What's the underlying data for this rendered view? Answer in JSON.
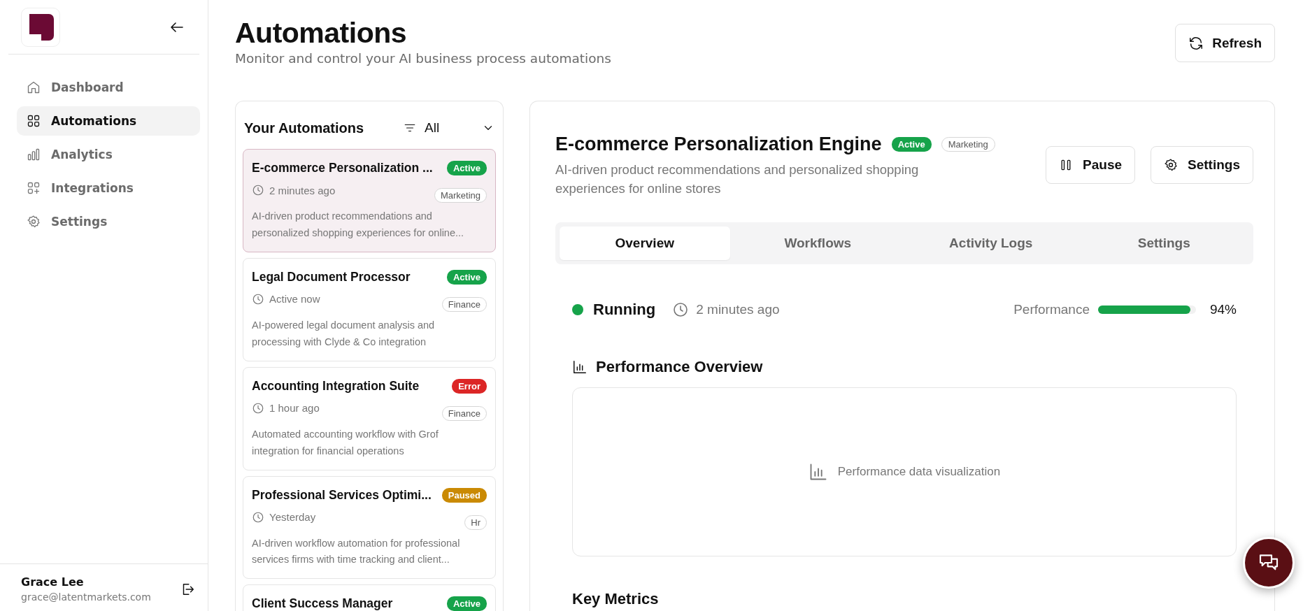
{
  "sidebar": {
    "nav": [
      {
        "label": "Dashboard",
        "selected": false
      },
      {
        "label": "Automations",
        "selected": true
      },
      {
        "label": "Analytics",
        "selected": false
      },
      {
        "label": "Integrations",
        "selected": false
      },
      {
        "label": "Settings",
        "selected": false
      }
    ],
    "user": {
      "name": "Grace Lee",
      "email": "grace@latentmarkets.com"
    }
  },
  "header": {
    "title": "Automations",
    "subtitle": "Monitor and control your AI business process automations",
    "refresh_button": "Refresh"
  },
  "automation_list": {
    "title": "Your Automations",
    "filter": "All",
    "items": [
      {
        "name": "E-commerce Personalization ...",
        "status": {
          "label": "Active",
          "color": "#16a34a"
        },
        "time": "2 minutes ago",
        "tag": "Marketing",
        "description": "AI-driven product recommendations and personalized shopping experiences for online...",
        "selected": true
      },
      {
        "name": "Legal Document Processor",
        "status": {
          "label": "Active",
          "color": "#16a34a"
        },
        "time": "Active now",
        "tag": "Finance",
        "description": "AI-powered legal document analysis and processing with Clyde & Co integration",
        "selected": false
      },
      {
        "name": "Accounting Integration Suite",
        "status": {
          "label": "Error",
          "color": "#dc2626"
        },
        "time": "1 hour ago",
        "tag": "Finance",
        "description": "Automated accounting workflow with Grof integration for financial operations",
        "selected": false
      },
      {
        "name": "Professional Services Optimi...",
        "status": {
          "label": "Paused",
          "color": "#ca8a04"
        },
        "time": "Yesterday",
        "tag": "Hr",
        "description": "AI-driven workflow automation for professional services firms with time tracking and client...",
        "selected": false
      },
      {
        "name": "Client Success Manager",
        "status": {
          "label": "Active",
          "color": "#16a34a"
        },
        "selected": false
      }
    ]
  },
  "detail": {
    "title": "E-commerce Personalization Engine",
    "status": {
      "label": "Active",
      "color": "#16a34a"
    },
    "tag": "Marketing",
    "description": "AI-driven product recommendations and personalized shopping experiences for online stores",
    "buttons": [
      "Pause",
      "Settings"
    ],
    "tabs": [
      {
        "label": "Overview",
        "selected": true
      },
      {
        "label": "Workflows",
        "selected": false
      },
      {
        "label": "Activity Logs",
        "selected": false
      },
      {
        "label": "Settings",
        "selected": false
      }
    ],
    "state": {
      "label": "Running",
      "color": "#16a34a"
    },
    "updated": "2 minutes ago",
    "performance": {
      "label": "Performance",
      "level": 0.94,
      "reading": "94%"
    },
    "overview_title": "Performance Overview",
    "placeholder_text": "Performance data visualization",
    "metrics_title": "Key Metrics"
  }
}
